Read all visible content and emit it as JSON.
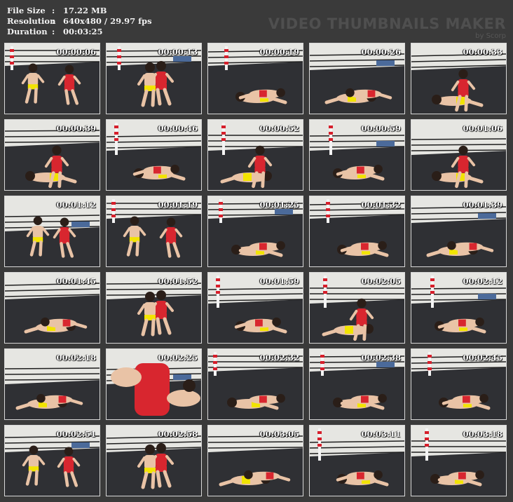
{
  "header": {
    "rows": [
      {
        "label": "File Size",
        "sep": ":",
        "value": "17.22 MB"
      },
      {
        "label": "Resolution",
        "sep": ":",
        "value": "640x480 / 29.97 fps"
      },
      {
        "label": "Duration",
        "sep": ":",
        "value": "00:03:25"
      }
    ],
    "brand_title": "VIDEO THUMBNAILS MAKER",
    "brand_sub": "by Scorp"
  },
  "thumbnails": [
    {
      "time": "00:00:06",
      "scene": "standing"
    },
    {
      "time": "00:00:13",
      "scene": "clinch"
    },
    {
      "time": "00:00:19",
      "scene": "floor"
    },
    {
      "time": "00:00:26",
      "scene": "floor"
    },
    {
      "time": "00:00:33",
      "scene": "sitting"
    },
    {
      "time": "00:00:39",
      "scene": "sitting"
    },
    {
      "time": "00:00:46",
      "scene": "floor"
    },
    {
      "time": "00:00:52",
      "scene": "sitting"
    },
    {
      "time": "00:00:59",
      "scene": "floor"
    },
    {
      "time": "00:01:06",
      "scene": "sitting"
    },
    {
      "time": "00:01:12",
      "scene": "standing"
    },
    {
      "time": "00:01:19",
      "scene": "standing"
    },
    {
      "time": "00:01:25",
      "scene": "floor"
    },
    {
      "time": "00:01:32",
      "scene": "floor"
    },
    {
      "time": "00:01:39",
      "scene": "floor"
    },
    {
      "time": "00:01:45",
      "scene": "floor"
    },
    {
      "time": "00:01:52",
      "scene": "clinch"
    },
    {
      "time": "00:01:59",
      "scene": "floor"
    },
    {
      "time": "00:02:05",
      "scene": "sitting"
    },
    {
      "time": "00:02:12",
      "scene": "floor"
    },
    {
      "time": "00:02:18",
      "scene": "floor"
    },
    {
      "time": "00:02:25",
      "scene": "closeup"
    },
    {
      "time": "00:02:32",
      "scene": "floor"
    },
    {
      "time": "00:02:38",
      "scene": "floor"
    },
    {
      "time": "00:02:45",
      "scene": "floor"
    },
    {
      "time": "00:02:51",
      "scene": "standing"
    },
    {
      "time": "00:02:58",
      "scene": "clinch"
    },
    {
      "time": "00:03:05",
      "scene": "floor"
    },
    {
      "time": "00:03:11",
      "scene": "floor"
    },
    {
      "time": "00:03:18",
      "scene": "floor"
    }
  ],
  "colors": {
    "background": "#3a3a3a",
    "thumb_border": "#d8d8d8",
    "mat": "#2f3034",
    "wall": "#e6e6e2",
    "rope_red": "#d61f2b",
    "suit_red": "#d8262f",
    "trunks_yellow": "#f2e400",
    "skin": "#e9c3a6"
  }
}
